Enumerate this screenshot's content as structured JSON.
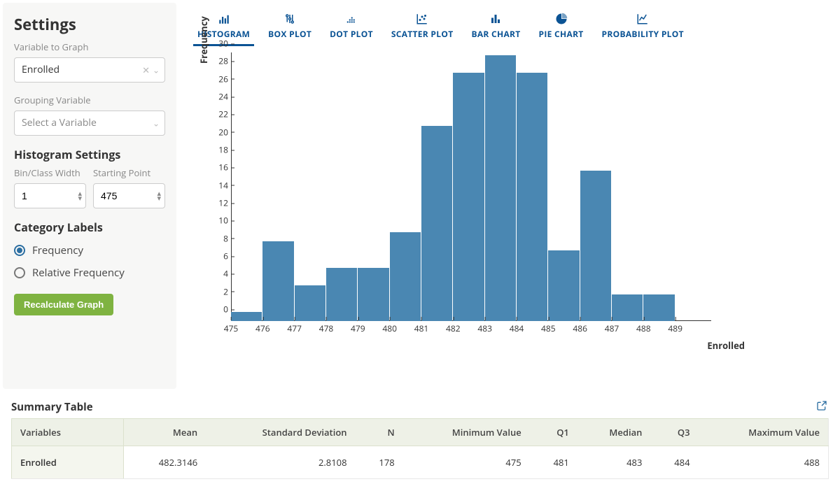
{
  "sidebar": {
    "title": "Settings",
    "var_to_graph_label": "Variable to Graph",
    "var_to_graph_value": "Enrolled",
    "grouping_label": "Grouping Variable",
    "grouping_placeholder": "Select a Variable",
    "hist_settings_title": "Histogram Settings",
    "bin_width_label": "Bin/Class Width",
    "bin_width_value": "1",
    "starting_point_label": "Starting Point",
    "starting_point_value": "475",
    "cat_labels_title": "Category Labels",
    "radio_frequency": "Frequency",
    "radio_relative": "Relative Frequency",
    "recalc_btn": "Recalculate Graph"
  },
  "tabs": [
    {
      "id": "histogram",
      "label": "HISTOGRAM",
      "active": true
    },
    {
      "id": "boxplot",
      "label": "BOX PLOT"
    },
    {
      "id": "dotplot",
      "label": "DOT PLOT"
    },
    {
      "id": "scatter",
      "label": "SCATTER PLOT"
    },
    {
      "id": "barchart",
      "label": "BAR CHART"
    },
    {
      "id": "piechart",
      "label": "PIE CHART"
    },
    {
      "id": "probability",
      "label": "PROBABILITY PLOT"
    }
  ],
  "chart_data": {
    "type": "bar",
    "title": "",
    "xlabel": "Enrolled",
    "ylabel": "Frequency",
    "categories": [
      "475",
      "476",
      "477",
      "478",
      "479",
      "480",
      "481",
      "482",
      "483",
      "484",
      "485",
      "486",
      "487",
      "488",
      "489"
    ],
    "values": [
      1,
      9,
      4,
      6,
      6,
      10,
      22,
      28,
      30,
      28,
      8,
      17,
      3,
      3,
      0
    ],
    "xlim": [
      475,
      489
    ],
    "ylim": [
      0,
      30
    ],
    "yticks": [
      0,
      2,
      4,
      6,
      8,
      10,
      12,
      14,
      16,
      18,
      20,
      22,
      24,
      26,
      28,
      30
    ]
  },
  "summary": {
    "title": "Summary Table",
    "columns": [
      "Variables",
      "Mean",
      "Standard Deviation",
      "N",
      "Minimum Value",
      "Q1",
      "Median",
      "Q3",
      "Maximum Value"
    ],
    "row": {
      "name": "Enrolled",
      "mean": "482.3146",
      "sd": "2.8108",
      "n": "178",
      "min": "475",
      "q1": "481",
      "median": "483",
      "q3": "484",
      "max": "488"
    }
  }
}
